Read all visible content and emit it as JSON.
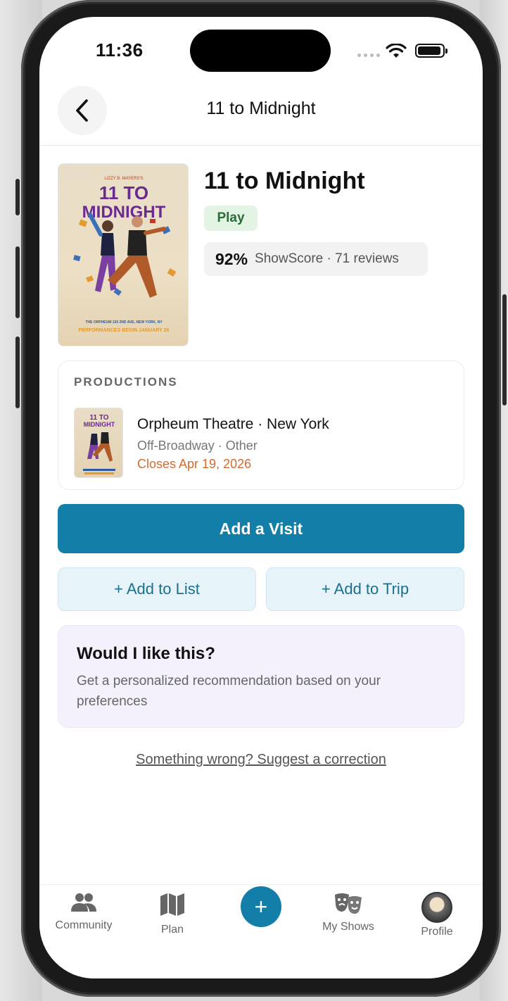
{
  "status_bar": {
    "time": "11:36"
  },
  "nav": {
    "title": "11 to Midnight"
  },
  "show": {
    "title": "11 to Midnight",
    "tag": "Play",
    "score_percent": "92%",
    "score_text": "ShowScore · 71 reviews",
    "poster": {
      "credit": "LIZZY B. MAYERS'S",
      "title_line1": "11 TO",
      "title_line2": "MIDNIGHT",
      "venue_line": "THE ORPHEUM 126 2ND AVE, NEW YORK, NY",
      "perf_line": "PERFORMANCES BEGIN JANUARY 26"
    }
  },
  "productions": {
    "heading": "PRODUCTIONS",
    "items": [
      {
        "venue": "Orpheum Theatre · New York",
        "type": "Off-Broadway · Other",
        "closes": "Closes Apr 19, 2026",
        "thumb_title_line1": "11 TO",
        "thumb_title_line2": "MIDNIGHT"
      }
    ]
  },
  "actions": {
    "add_visit": "Add a Visit",
    "add_to_list": "+ Add to List",
    "add_to_trip": "+ Add to Trip"
  },
  "recommendation": {
    "title": "Would I like this?",
    "description": "Get a personalized recommendation based on your preferences"
  },
  "correction_link": "Something wrong? Suggest a correction",
  "tabbar": {
    "items": [
      {
        "label": "Community",
        "icon": "people-icon"
      },
      {
        "label": "Plan",
        "icon": "map-icon"
      },
      {
        "label": "",
        "icon": "plus-icon"
      },
      {
        "label": "My Shows",
        "icon": "theater-masks-icon"
      },
      {
        "label": "Profile",
        "icon": "avatar"
      }
    ]
  },
  "colors": {
    "accent": "#137ea7",
    "tag_bg": "#e3f4e5",
    "tag_text": "#2b6b36",
    "closes_text": "#d66a2c",
    "rec_bg": "#f4f1fd"
  }
}
